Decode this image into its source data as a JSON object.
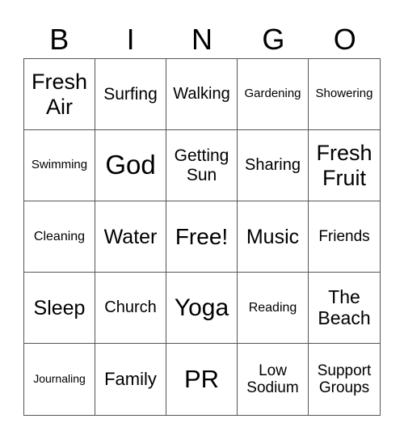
{
  "header": {
    "letters": [
      "B",
      "I",
      "N",
      "G",
      "O"
    ]
  },
  "cells": [
    [
      "Fresh Air",
      "Surfing",
      "Walking",
      "Gardening",
      "Showering"
    ],
    [
      "Swimming",
      "God",
      "Getting Sun",
      "Sharing",
      "Fresh Fruit"
    ],
    [
      "Cleaning",
      "Water",
      "Free!",
      "Music",
      "Friends"
    ],
    [
      "Sleep",
      "Church",
      "Yoga",
      "Reading",
      "The Beach"
    ],
    [
      "Journaling",
      "Family",
      "PR",
      "Low Sodium",
      "Support Groups"
    ]
  ]
}
